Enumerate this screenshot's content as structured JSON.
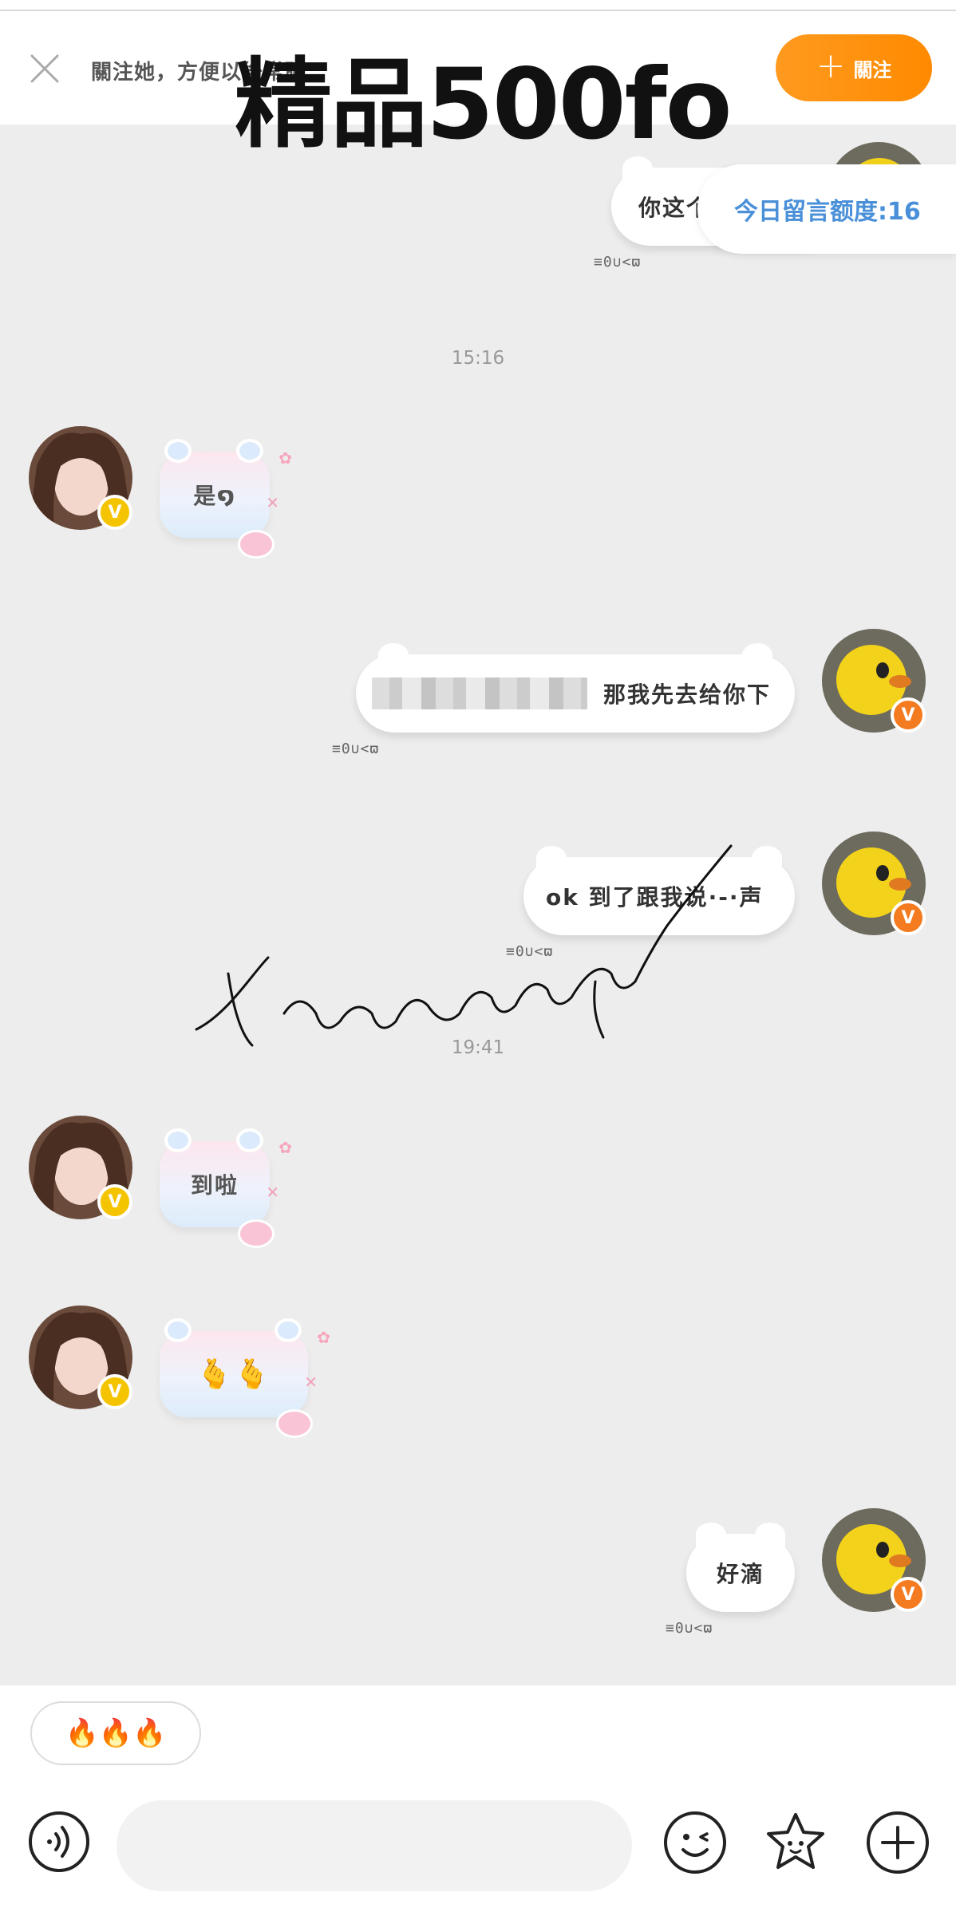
{
  "header": {
    "close_icon": "close-icon",
    "hint": "關注她，方便以後常聊",
    "follow_label": "關注",
    "follow_plus": "+",
    "accent": "#ff9100"
  },
  "watermark": {
    "title": "精品500fo",
    "script": "tianmangin"
  },
  "quota": {
    "label": "今日留言额度:16",
    "color": "#4a90d9"
  },
  "messages": {
    "m1": {
      "text": "你这个",
      "status": "≡0∪<ϖ"
    },
    "ts1": "15:16",
    "m2": {
      "text": "是໑"
    },
    "m3": {
      "text": "那我先去给你下",
      "status": "≡0∪<ϖ"
    },
    "m4": {
      "text": "ok 到了跟我说·-·声",
      "status": "≡0∪<ϖ"
    },
    "ts2": "19:41",
    "m5": {
      "text": "到啦"
    },
    "m6": {
      "text": "🫰🫰"
    },
    "m7": {
      "text": "好滴",
      "status": "≡0∪<ϖ"
    }
  },
  "badges": {
    "gold": "V",
    "orange": "V"
  },
  "bottom": {
    "quick_reply": "🔥🔥🔥",
    "input_placeholder": "",
    "icons": [
      "voice-icon",
      "emoji-icon",
      "sticker-icon",
      "plus-icon"
    ]
  }
}
